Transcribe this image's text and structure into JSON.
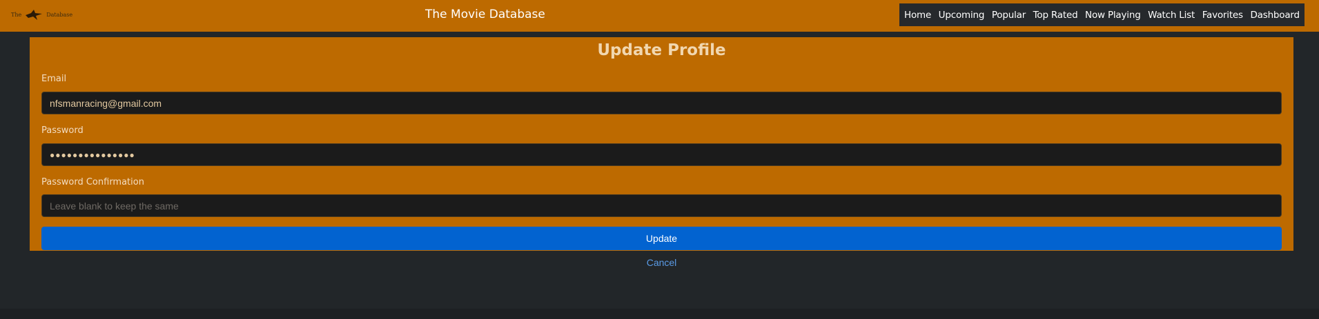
{
  "navbar": {
    "logo_text_left": "The",
    "logo_text_right": "Database",
    "logo_icon": "bird-icon",
    "title": "The Movie Database",
    "links": [
      "Home",
      "Upcoming",
      "Popular",
      "Top Rated",
      "Now Playing",
      "Watch List",
      "Favorites",
      "Dashboard"
    ]
  },
  "form": {
    "title": "Update Profile",
    "email_label": "Email",
    "email_value": "nfsmanracing@gmail.com",
    "password_label": "Password",
    "password_value": "●●●●●●●●●●●●●●●",
    "password_confirmation_label": "Password Confirmation",
    "password_confirmation_placeholder": "Leave blank to keep the same",
    "update_label": "Update",
    "cancel_label": "Cancel"
  },
  "colors": {
    "accent": "#bd6a00",
    "background": "#222629",
    "button": "#0263d0",
    "link": "#5a9be6"
  }
}
